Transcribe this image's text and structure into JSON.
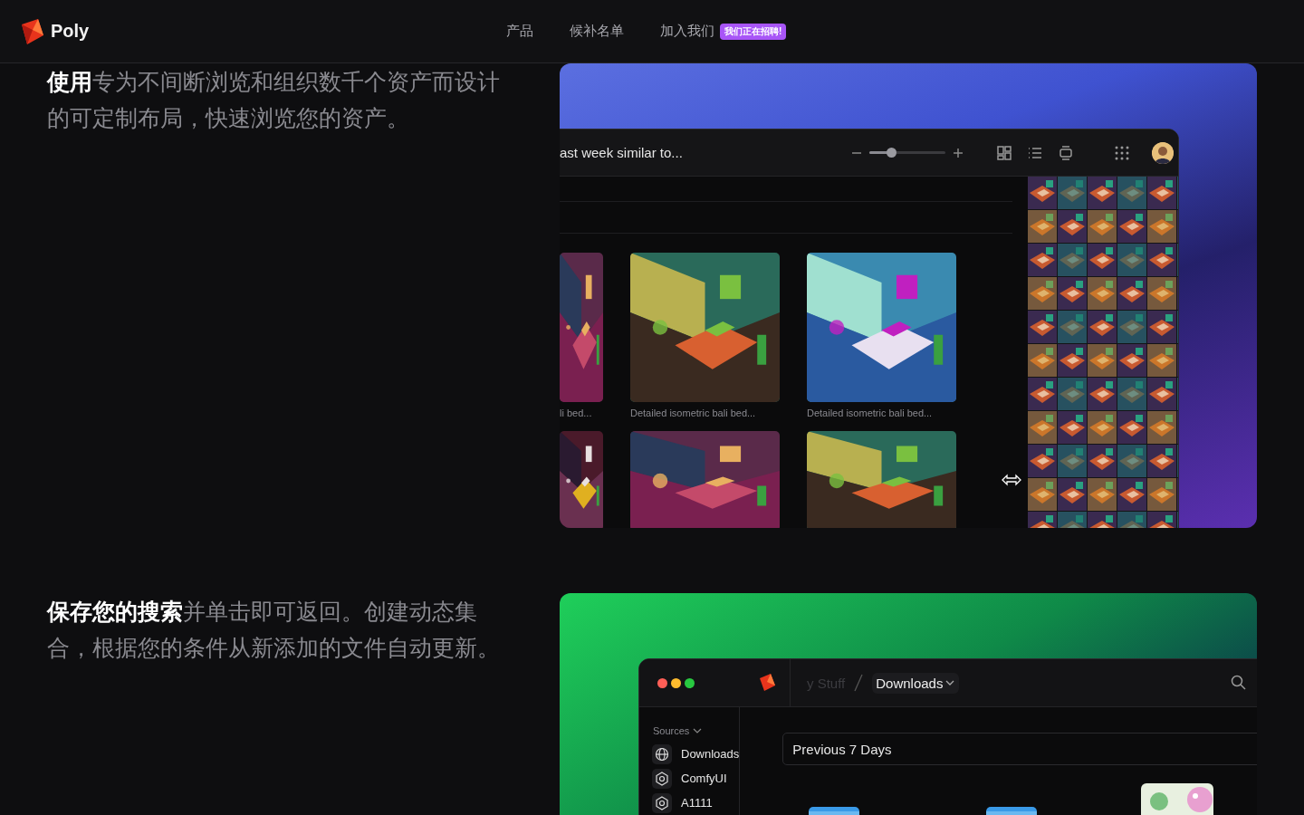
{
  "nav": {
    "brand": "Poly",
    "links": [
      {
        "label": "产品"
      },
      {
        "label": "候补名单"
      },
      {
        "label": "加入我们",
        "badge": "我们正在招聘!"
      }
    ]
  },
  "features": [
    {
      "lead": "使用",
      "text": "专为不间断浏览和组织数千个资产而设计的可定制布局，快速浏览您的资产。",
      "app": {
        "kind": "browser",
        "title": "ast week similar to...",
        "zoom": {
          "level": 0.28
        },
        "cards": [
          {
            "kind": "picture",
            "caption": "li bed..."
          },
          {
            "kind": "picture",
            "caption": "Detailed isometric bali bed..."
          },
          {
            "kind": "picture",
            "caption": "Detailed isometric bali bed..."
          },
          {
            "kind": "picture"
          },
          {
            "kind": "picture"
          },
          {
            "kind": "picture"
          }
        ]
      }
    },
    {
      "lead": "保存您的搜索",
      "text": "并单击即可返回。创建动态集合，根据您的条件从新添加的文件自动更新。",
      "app": {
        "kind": "library",
        "breadcrumb": [
          {
            "label": "y Stuff",
            "current": false
          },
          {
            "label": "Downloads",
            "current": true
          }
        ],
        "sources_label": "Sources",
        "sources": [
          {
            "kind": "web",
            "label": "Downloads"
          },
          {
            "kind": "tool",
            "label": "ComfyUI"
          },
          {
            "kind": "tool",
            "label": "A1111"
          }
        ],
        "filter": "Previous 7 Days"
      }
    }
  ]
}
